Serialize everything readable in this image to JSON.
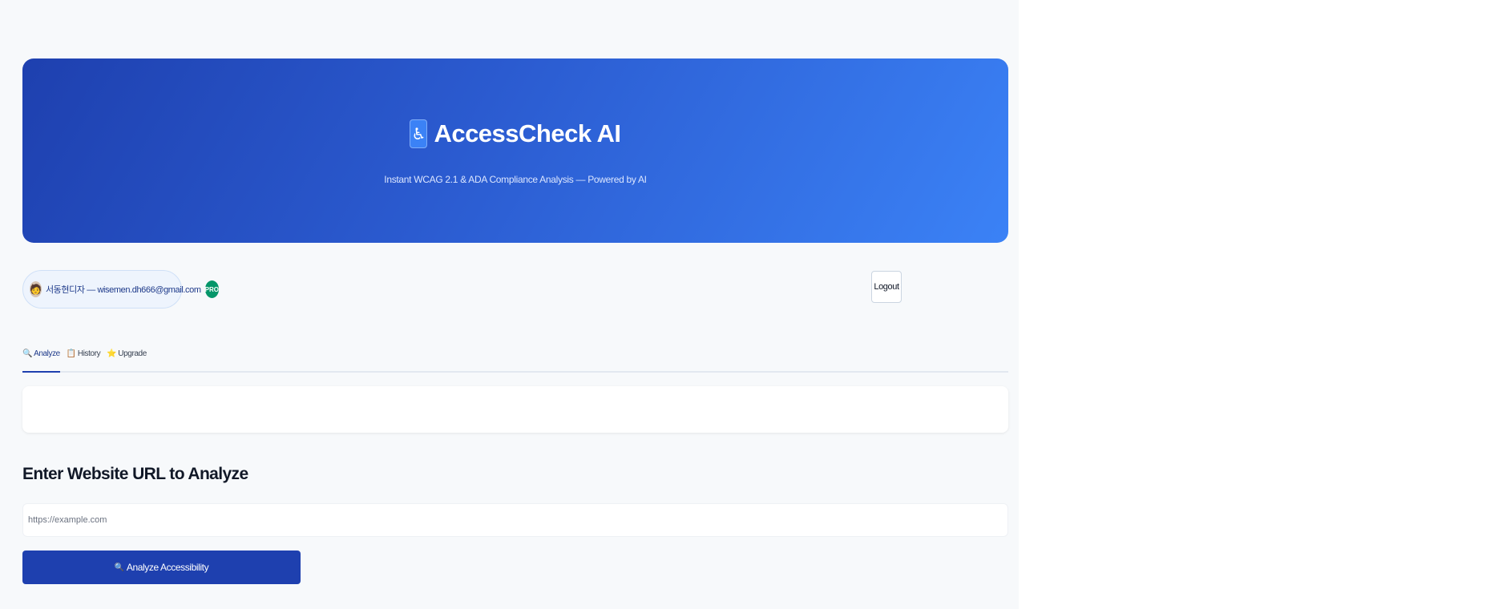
{
  "hero": {
    "logo_icon": "♿",
    "title": "AccessCheck AI",
    "subtitle": "Instant WCAG 2.1 & ADA Compliance Analysis — Powered by AI"
  },
  "user": {
    "avatar_icon": "🧑",
    "label": "서동현디자 — wisemen.dh666@gmail.com",
    "plan_badge": "PRO"
  },
  "header": {
    "logout_label": "Logout"
  },
  "tabs": [
    {
      "icon": "🔍",
      "label": "Analyze",
      "active": true
    },
    {
      "icon": "📋",
      "label": "History",
      "active": false
    },
    {
      "icon": "⭐",
      "label": "Upgrade",
      "active": false
    }
  ],
  "analyze": {
    "heading": "Enter Website URL to Analyze",
    "url_placeholder": "https://example.com",
    "url_value": "",
    "button_icon": "🔍",
    "button_label": "Analyze Accessibility"
  },
  "colors": {
    "brand_primary": "#1e40af",
    "brand_secondary": "#3b82f6",
    "badge_green": "#059669",
    "page_bg": "#f7f9fb"
  }
}
